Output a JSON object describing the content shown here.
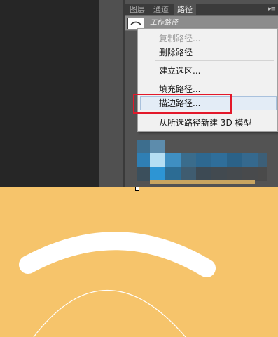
{
  "panel": {
    "tabs": [
      "图层",
      "通道",
      "路径"
    ],
    "active_tab": "路径",
    "menu_icon": "panel-menu-icon",
    "path_name": "工作路径"
  },
  "context_menu": {
    "items": [
      {
        "label": "复制路径...",
        "enabled": false
      },
      {
        "label": "删除路径",
        "enabled": true
      },
      {
        "label": "建立选区...",
        "enabled": true
      },
      {
        "label": "填充路径...",
        "enabled": true
      },
      {
        "label": "描边路径...",
        "enabled": true,
        "highlighted": true
      },
      {
        "label": "从所选路径新建 3D 模型",
        "enabled": true
      }
    ]
  },
  "colors": {
    "canvas_background": "#f6c46b",
    "stroke": "#ffffff",
    "highlight_box": "#e3182a"
  }
}
